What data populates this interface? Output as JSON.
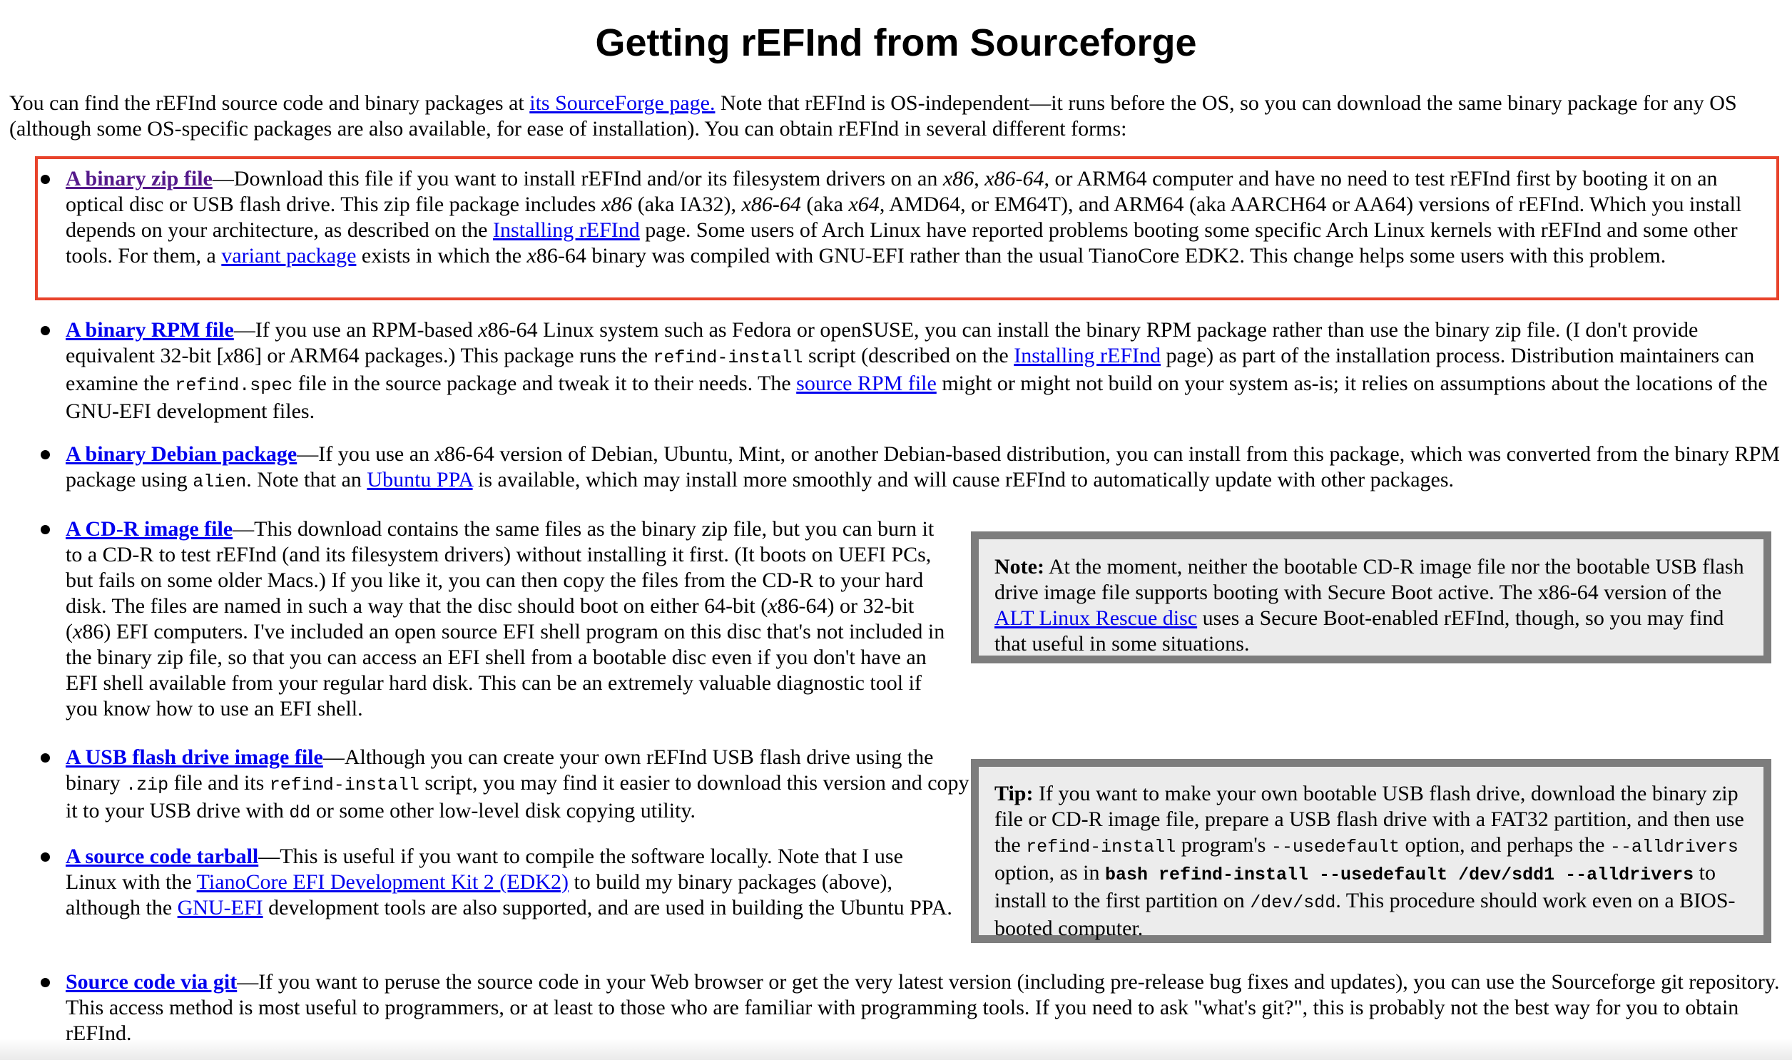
{
  "title": "Getting rEFInd from Sourceforge",
  "intro": {
    "t1": "You can find the rEFInd source code and binary packages at ",
    "link": "its SourceForge page.",
    "t2": " Note that rEFInd is OS-independent—it runs before the OS, so you can download the same binary package for any OS (although some OS-specific packages are also available, for ease of installation). You can obtain rEFInd in several different forms:"
  },
  "items": {
    "zip": {
      "link": "A binary zip file",
      "t1": "—Download this file if you want to install rEFInd and/or its filesystem drivers on an ",
      "t2": "x86",
      "t3": ", ",
      "t4": "x86-64",
      "t5": ", or ARM64 computer and have no need to test rEFInd first by booting it on an optical disc or USB flash drive. This zip file package includes ",
      "t6": "x86",
      "t7": " (aka IA32), ",
      "t8": "x86-64",
      "t9": " (aka ",
      "t10": "x64",
      "t11": ", AMD64, or EM64T), and ARM64 (aka AARCH64 or AA64) versions of rEFInd. Which you install depends on your architecture, as described on the ",
      "link2": "Installing rEFInd",
      "t12": " page. Some users of Arch Linux have reported problems booting some specific Arch Linux kernels with rEFInd and some other tools. For them, a ",
      "link3": "variant package",
      "t13": " exists in which the ",
      "t14": "x",
      "t15": "86-64 binary was compiled with GNU-EFI rather than the usual TianoCore EDK2. This change helps some users with this problem."
    },
    "rpm": {
      "link": "A binary RPM file",
      "t1": "—If you use an RPM-based ",
      "t2": "x",
      "t3": "86-64 Linux system such as Fedora or openSUSE, you can install the binary RPM package rather than use the binary zip file. (I don't provide equivalent 32-bit [",
      "t4": "x",
      "t5": "86] or ARM64 packages.) This package runs the ",
      "code1": "refind-install",
      "t6": " script (described on the ",
      "link2": "Installing rEFInd",
      "t7": " page) as part of the installation process. Distribution maintainers can examine the ",
      "code2": "refind.spec",
      "t8": " file in the source package and tweak it to their needs. The ",
      "link3": "source RPM file",
      "t9": " might or might not build on your system as-is; it relies on assumptions about the locations of the GNU-EFI development files."
    },
    "deb": {
      "link": "A binary Debian package",
      "t1": "—If you use an ",
      "t2": "x",
      "t3": "86-64 version of Debian, Ubuntu, Mint, or another Debian-based distribution, you can install from this package, which was converted from the binary RPM package using ",
      "code1": "alien",
      "t4": ". Note that an ",
      "link2": "Ubuntu PPA",
      "t5": " is available, which may install more smoothly and will cause rEFInd to automatically update with other packages."
    },
    "cdr": {
      "link": "A CD-R image file",
      "t1": "—This download contains the same files as the binary zip file, but you can burn it to a CD-R to test rEFInd (and its filesystem drivers) without installing it first. (It boots on UEFI PCs, but fails on some older Macs.) If you like it, you can then copy the files from the CD-R to your hard disk. The files are named in such a way that the disc should boot on either 64-bit (",
      "t2": "x",
      "t3": "86-64) or 32-bit (",
      "t4": "x",
      "t5": "86) EFI computers. I've included an open source EFI shell program on this disc that's not included in the binary zip file, so that you can access an EFI shell from a bootable disc even if you don't have an EFI shell available from your regular hard disk. This can be an extremely valuable diagnostic tool if you know how to use an EFI shell."
    },
    "usb": {
      "link": "A USB flash drive image file",
      "t1": "—Although you can create your own rEFInd USB flash drive using the binary ",
      "code1": ".zip",
      "t2": " file and its ",
      "code2": "refind-install",
      "t3": " script, you may find it easier to download this version and copy it to your USB drive with ",
      "code3": "dd",
      "t4": " or some other low-level disk copying utility."
    },
    "tarball": {
      "link": "A source code tarball",
      "t1": "—This is useful if you want to compile the software locally. Note that I use Linux with the ",
      "link2": "TianoCore EFI Development Kit 2 (EDK2)",
      "t2": " to build my binary packages (above), although the ",
      "link3": "GNU-EFI",
      "t3": " development tools are also supported, and are used in building the Ubuntu PPA."
    },
    "git": {
      "link": "Source code via git",
      "t1": "—If you want to peruse the source code in your Web browser or get the very latest version (including pre-release bug fixes and updates), you can use the Sourceforge git repository. This access method is most useful to programmers, or at least to those who are familiar with programming tools. If you need to ask \"what's git?\", this is probably not the best way for you to obtain rEFInd."
    }
  },
  "note": {
    "label": "Note:",
    "t1": " At the moment, neither the bootable CD-R image file nor the bootable USB flash drive image file supports booting with Secure Boot active. The x86-64 version of the ",
    "link": "ALT Linux Rescue disc",
    "t2": " uses a Secure Boot-enabled rEFInd, though, so you may find that useful in some situations."
  },
  "tip": {
    "label": "Tip:",
    "t1": " If you want to make your own bootable USB flash drive, download the binary zip file or CD-R image file, prepare a USB flash drive with a FAT32 partition, and then use the ",
    "code1": "refind-install",
    "t2": " program's ",
    "code2": "--usedefault",
    "t3": " option, and perhaps the ",
    "code3": "--alldrivers",
    "t4": " option, as in ",
    "code4": "bash refind-install --usedefault /dev/sdd1 --alldrivers",
    "t5": " to install to the first partition on ",
    "code5": "/dev/sdd",
    "t6": ". This procedure should work even on a BIOS-booted computer."
  },
  "colors": {
    "link": "#0000ee",
    "visited_link": "#551a8b",
    "highlight_border": "#e8432b",
    "box_border": "#7d7d7d",
    "box_background": "#ececec"
  }
}
